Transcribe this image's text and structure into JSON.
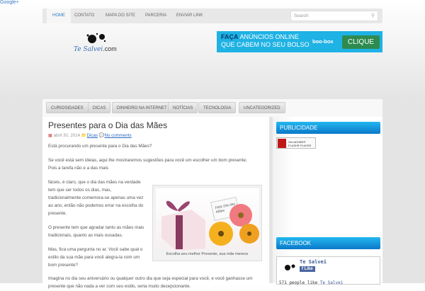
{
  "google_plus": "Google+",
  "top_nav": [
    "HOME",
    "CONTATO",
    "MAPA DO SITE",
    "PARCERIA",
    "ENVIAR LINK"
  ],
  "search": {
    "placeholder": "Search"
  },
  "logo": {
    "name": "Te Salvei",
    "suffix": ".com"
  },
  "ad": {
    "highlight": "FAÇA",
    "line1": "ANÚNCIOS ONLINE",
    "line2": "QUE CABEM NO SEU BOLSO",
    "brand": "boo-box",
    "cta": "CLIQUE"
  },
  "categories": [
    "CURIOSIDADES",
    "DICAS",
    "DINHEIRO NA INTERNET",
    "NOTÍCIAS",
    "TECNOLOGIA",
    "UNCATEGORIZED"
  ],
  "post": {
    "title": "Presentes para o Dia das Mães",
    "date": "abril 30, 2014",
    "category": "Dicas",
    "comments": "No comments",
    "paragraphs": [
      "Está procurando um presente para o Dia das Mães?",
      "Se você está sem ideias, aqui lhe mostraremos sugestões para você um escolher um bom presente;",
      "Pois a tarefa não e a das mais",
      "fáceis, é claro, que o dia das mães na verdade",
      "tem que ser todos os dias, mas,",
      "tradicionalmente comemora-se apenas uma vez",
      "ao ano, então não podemos errar na escolha do",
      "presente.",
      "O presente tem que agradar tanto as mães mais",
      "tradicionais, quanto as mais ousadas.",
      "Mas, fica uma pergunta no ar. Você sabe qual o",
      "estilo da sua mãe para você alegra-la com um",
      "bom presente?",
      "Imagina no dia seu aniversário ou qualquer outro dia que seja especial para você, e você ganhasse um",
      "presente que não nada a ver com seu estilo, seria muito decepcionante."
    ],
    "image_card": "Feliz Dia das Mães",
    "caption": "Escolha seu melhor Presente, sua mãe merece"
  },
  "sidebar": {
    "publicidade": "PUBLICIDADE",
    "flash": {
      "line1": "Get ADOBE®",
      "line2": "FLASH® PLAYER"
    },
    "facebook": "FACEBOOK",
    "fb_page": "Te Salvei",
    "fb_like": "Like",
    "fb_count": "571 people like",
    "fb_count_name": "Te Salvei"
  }
}
